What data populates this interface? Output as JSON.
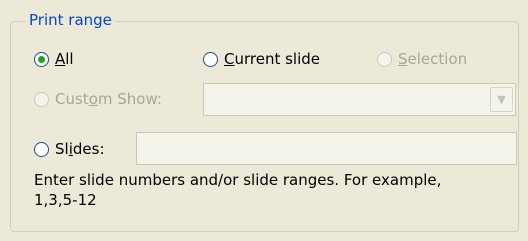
{
  "group": {
    "title": "Print range"
  },
  "options": {
    "all": {
      "pre": "",
      "mnemonic": "A",
      "post": "ll",
      "checked": true,
      "enabled": true
    },
    "current_slide": {
      "pre": "",
      "mnemonic": "C",
      "post": "urrent slide",
      "checked": false,
      "enabled": true
    },
    "selection": {
      "pre": "",
      "mnemonic": "S",
      "post": "election",
      "checked": false,
      "enabled": false
    },
    "custom_show": {
      "pre": "Cust",
      "mnemonic": "o",
      "post": "m Show:",
      "checked": false,
      "enabled": false
    },
    "slides": {
      "pre": "Sl",
      "mnemonic": "i",
      "post": "des:",
      "checked": false,
      "enabled": true
    }
  },
  "custom_show_select": {
    "value": "",
    "arrow_icon": "chevron-down-icon"
  },
  "slides_input": {
    "value": ""
  },
  "hint": {
    "line1": "Enter slide numbers and/or slide ranges. For example,",
    "line2": "1,3,5-12"
  },
  "colors": {
    "legend": "#0046d5",
    "background": "#ece9d8",
    "radio_dot": "#21a121",
    "disabled_text": "#a7a692"
  }
}
